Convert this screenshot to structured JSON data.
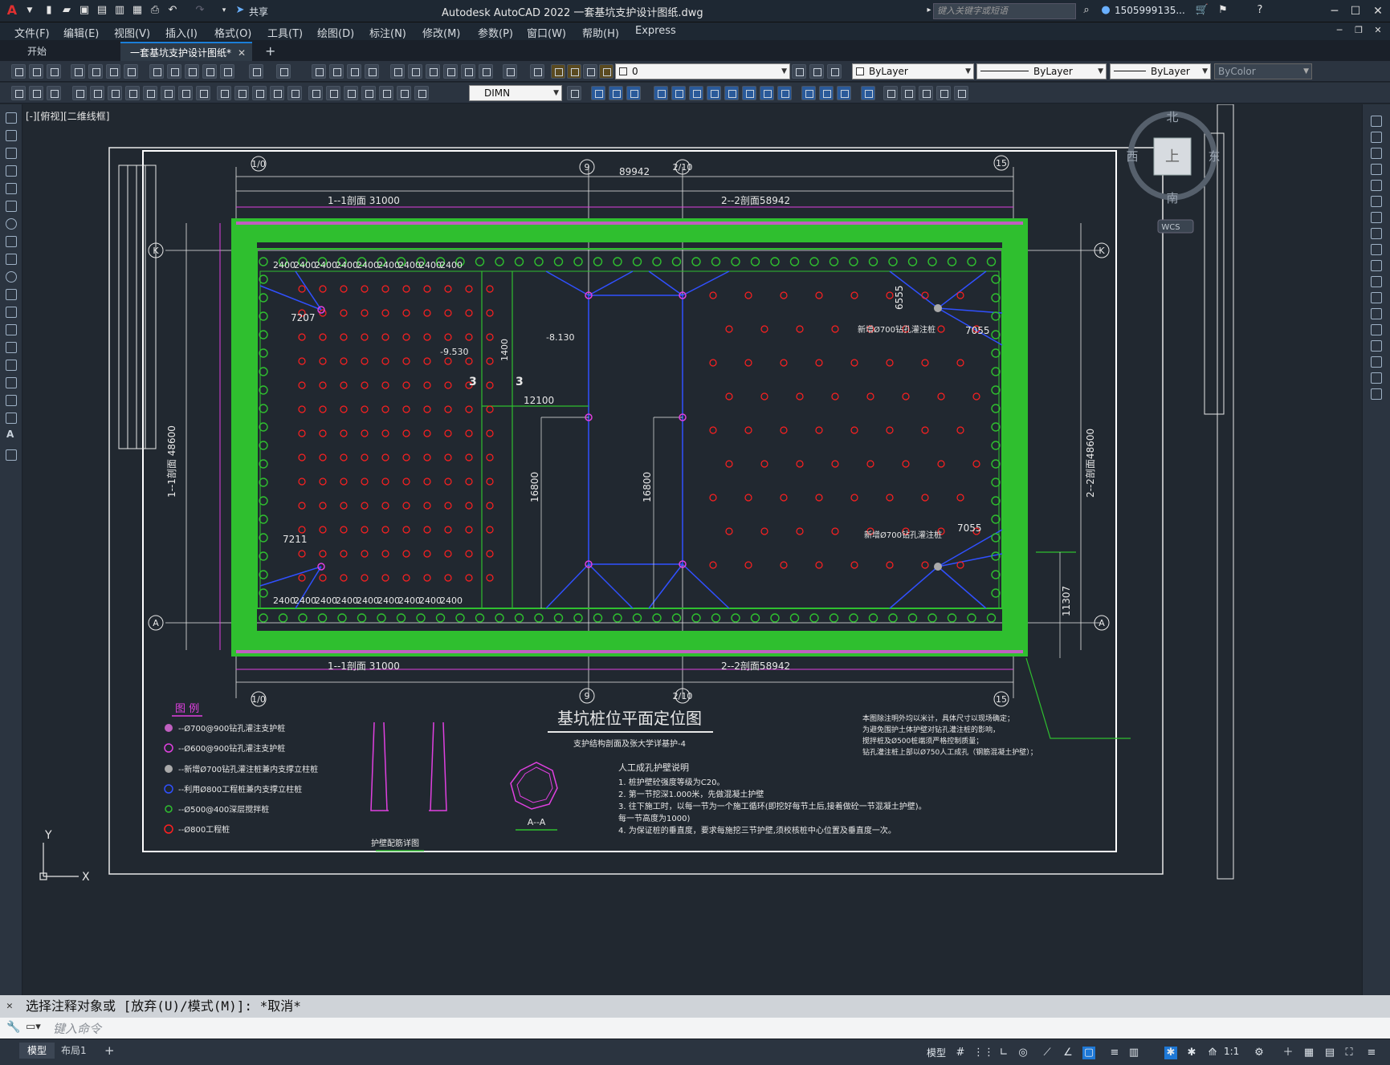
{
  "titlebar": {
    "app_title": "Autodesk AutoCAD 2022    一套基坑支护设计图纸.dwg",
    "share_label": "共享",
    "search_placeholder": "键入关键字或短语",
    "user": "1505999135..."
  },
  "menu": [
    "文件(F)",
    "编辑(E)",
    "视图(V)",
    "插入(I)",
    "格式(O)",
    "工具(T)",
    "绘图(D)",
    "标注(N)",
    "修改(M)",
    "参数(P)",
    "窗口(W)",
    "帮助(H)",
    "Express"
  ],
  "tabs": {
    "start": "开始",
    "drawing": "一套基坑支护设计图纸*"
  },
  "properties": {
    "layer_value": "0",
    "color": "ByLayer",
    "linetype": "ByLayer",
    "lineweight": "ByLayer",
    "plotstyle": "ByColor",
    "dimstyle": "DIMN"
  },
  "viewport": {
    "label": "[-][俯视][二维线框]"
  },
  "viewcube": {
    "north": "北",
    "south": "南",
    "west": "西",
    "east": "东",
    "top_face": "上",
    "wcs": "WCS"
  },
  "drawing": {
    "title": "基坑桩位平面定位图",
    "subtitle": "支护结构剖面及张大学详基护-4",
    "total_width": "89942",
    "height_dim": "48600",
    "dim_top_left": "1--1剖面  31000",
    "dim_top_right": "2--2剖面58942",
    "grid_top": [
      "1/0",
      "9",
      "2/10",
      "15"
    ],
    "axis_left": [
      "K",
      "A"
    ],
    "left_dim_label": "1--1剖面  48600",
    "right_dim_label": "2--2剖面48600",
    "spacing_label": "2400",
    "annotations": {
      "elev1": "-8.130",
      "elev2": "-9.530",
      "d1400": "1400",
      "d12100": "12100",
      "d16800": "16800",
      "d7207": "7207",
      "d7211": "7211",
      "d6555": "6555",
      "d7055": "7055",
      "d11307": "11307",
      "new_pile": "新增Ø700钻孔灌注桩",
      "sec3": "3"
    },
    "legend_title": "图  例",
    "legend": [
      "--Ø700@900钻孔灌注支护桩",
      "--Ø600@900钻孔灌注支护桩",
      "--新增Ø700钻孔灌注桩兼内支撑立柱桩",
      "--利用Ø800工程桩兼内支撑立柱桩",
      "--Ø500@400深层搅拌桩",
      "--Ø800工程桩"
    ],
    "detail_label": "护壁配筋详图",
    "section_label": "A--A",
    "notes_title": "人工成孔护壁说明",
    "notes": [
      "1. 桩护壁砼强度等级为C20。",
      "2. 第一节挖深1.000米，先做混凝土护壁",
      "3. 往下施工时，以每一节为一个施工循环(即挖好每节土后,接着做砼一节混凝土护壁)。",
      "   每一节高度为1000)",
      "4. 为保证桩的垂直度，要求每施挖三节护壁,须校核桩中心位置及垂直度一次。"
    ],
    "right_notes": [
      "本图除注明外均以米计，具体尺寸以现场确定；",
      "为避免围护土体护壁对钻孔灌注桩的影响，",
      "搅拌桩及Ø500桩端须严格控制质量；",
      "钻孔灌注桩上部以Ø750人工成孔（钢筋混凝土护壁）；"
    ]
  },
  "command": {
    "history": "选择注释对象或 [放弃(U)/模式(M)]: *取消*",
    "placeholder": "键入命令"
  },
  "status": {
    "model_tab": "模型",
    "layout_tab": "布局1",
    "model_label": "模型",
    "scale": "1:1"
  }
}
